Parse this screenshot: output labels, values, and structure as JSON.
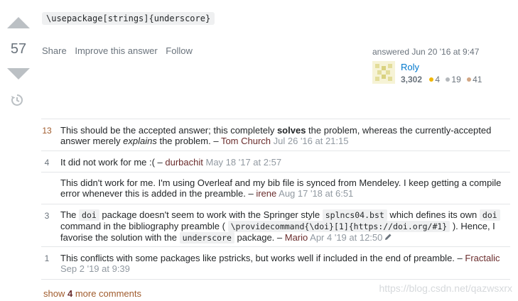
{
  "code": "\\usepackage[strings]{underscore}",
  "votes": {
    "count": "57"
  },
  "menu": {
    "share": "Share",
    "improve": "Improve this answer",
    "follow": "Follow"
  },
  "user": {
    "answered": "answered Jun 20 '16 at 9:47",
    "name": "Roly",
    "reputation": "3,302",
    "gold": "4",
    "silver": "19",
    "bronze": "41",
    "badge_colors": {
      "gold": "#f1b600",
      "silver": "#b4b8bc",
      "bronze": "#d1a684"
    }
  },
  "comments": [
    {
      "score": "13",
      "p1": "This should be the accepted answer; this completely ",
      "bold": "solves",
      "p2": " the problem, whereas the currently-accepted answer merely ",
      "em": "explains",
      "p3": " the problem. – ",
      "author": "Tom Church",
      "date": "Jul 26 '16 at 21:15"
    },
    {
      "score": "4",
      "text": "It did not work for me :( – ",
      "author": "durbachit",
      "date": "May 18 '17 at 2:57"
    },
    {
      "score": "",
      "text": "This didn't work for me. I'm using Overleaf and my bib file is synced from Mendeley. I keep getting a compile error whenever this is added in the preamble. – ",
      "author": "irene",
      "date": "Aug 17 '18 at 6:51"
    },
    {
      "score": "3",
      "t1": "The ",
      "c1": "doi",
      "t2": " package doesn't seem to work with the Springer style ",
      "c2": "splncs04.bst",
      "t3": " which defines its own ",
      "c3": "doi",
      "t4": " command in the bibliography preamble ( ",
      "c4": "\\providecommand{\\doi}[1]{https://doi.org/#1}",
      "t5": " ). Hence, I favorise the solution with the ",
      "c5": "underscore",
      "t6": " package. – ",
      "author": "Mario",
      "date": "Apr 4 '19 at 12:50"
    },
    {
      "score": "1",
      "text": "This conflicts with some packages like pstricks, but works well if included in the end of preamble. – ",
      "author": "Fractalic",
      "date": "Sep 2 '19 at 9:39"
    }
  ],
  "show_more": {
    "prefix": "show ",
    "count": "4",
    "suffix": " more comments"
  },
  "watermark": "https://blog.csdn.net/qazwsxrx"
}
